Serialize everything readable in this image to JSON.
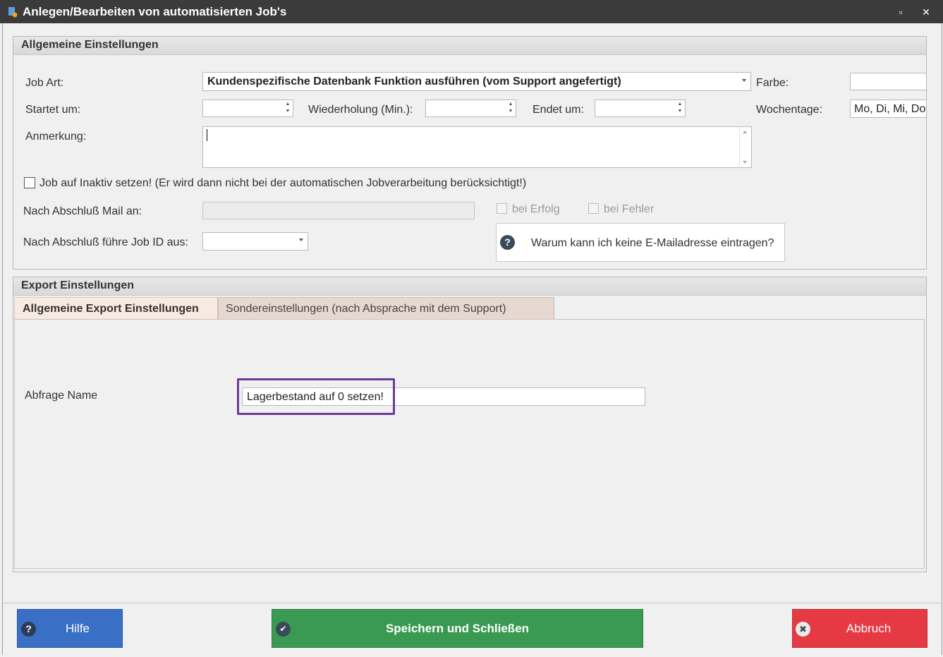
{
  "window": {
    "title": "Anlegen/Bearbeiten von automatisierten Job's",
    "maximize_glyph": "▫",
    "close_glyph": "✕"
  },
  "general": {
    "header": "Allgemeine Einstellungen",
    "job_art_label": "Job Art:",
    "job_art_value": "Kundenspezifische Datenbank Funktion ausführen (vom Support angefertigt)",
    "farbe_label": "Farbe:",
    "farbe_value": "",
    "startet_label": "Startet um:",
    "startet_value": "",
    "wiederholung_label": "Wiederholung (Min.):",
    "wiederholung_value": "",
    "endet_label": "Endet um:",
    "endet_value": "",
    "wochentage_label": "Wochentage:",
    "wochentage_value": "Mo, Di, Mi, Do",
    "anmerkung_label": "Anmerkung:",
    "anmerkung_value": "",
    "inaktiv_label": "Job auf Inaktiv setzen! (Er wird dann nicht bei der automatischen Jobverarbeitung berücksichtigt!)",
    "inaktiv_checked": false,
    "mail_label": "Nach Abschluß Mail an:",
    "mail_value": "",
    "bei_erfolg_label": "bei Erfolg",
    "bei_fehler_label": "bei Fehler",
    "job_id_label": "Nach Abschluß führe Job ID aus:",
    "job_id_value": "",
    "info_text": "Warum kann ich keine E-Mailadresse eintragen?"
  },
  "export": {
    "header": "Export Einstellungen",
    "tabs": [
      {
        "label": "Allgemeine Export Einstellungen",
        "active": true
      },
      {
        "label": "Sondereinstellungen (nach Absprache mit dem Support)",
        "active": false
      }
    ],
    "abfrage_label": "Abfrage Name",
    "abfrage_value": "Lagerbestand auf 0 setzen!"
  },
  "footer": {
    "hilfe_label": "Hilfe",
    "speichern_label": "Speichern und Schließen",
    "abbruch_label": "Abbruch"
  },
  "colors": {
    "hilfe": "#3a6fc6",
    "speichern": "#3a9a52",
    "abbruch": "#e53a44",
    "highlight": "#6a3a9a",
    "active_tab": "#f8e9e1",
    "inactive_tab": "#e6d8d0"
  }
}
